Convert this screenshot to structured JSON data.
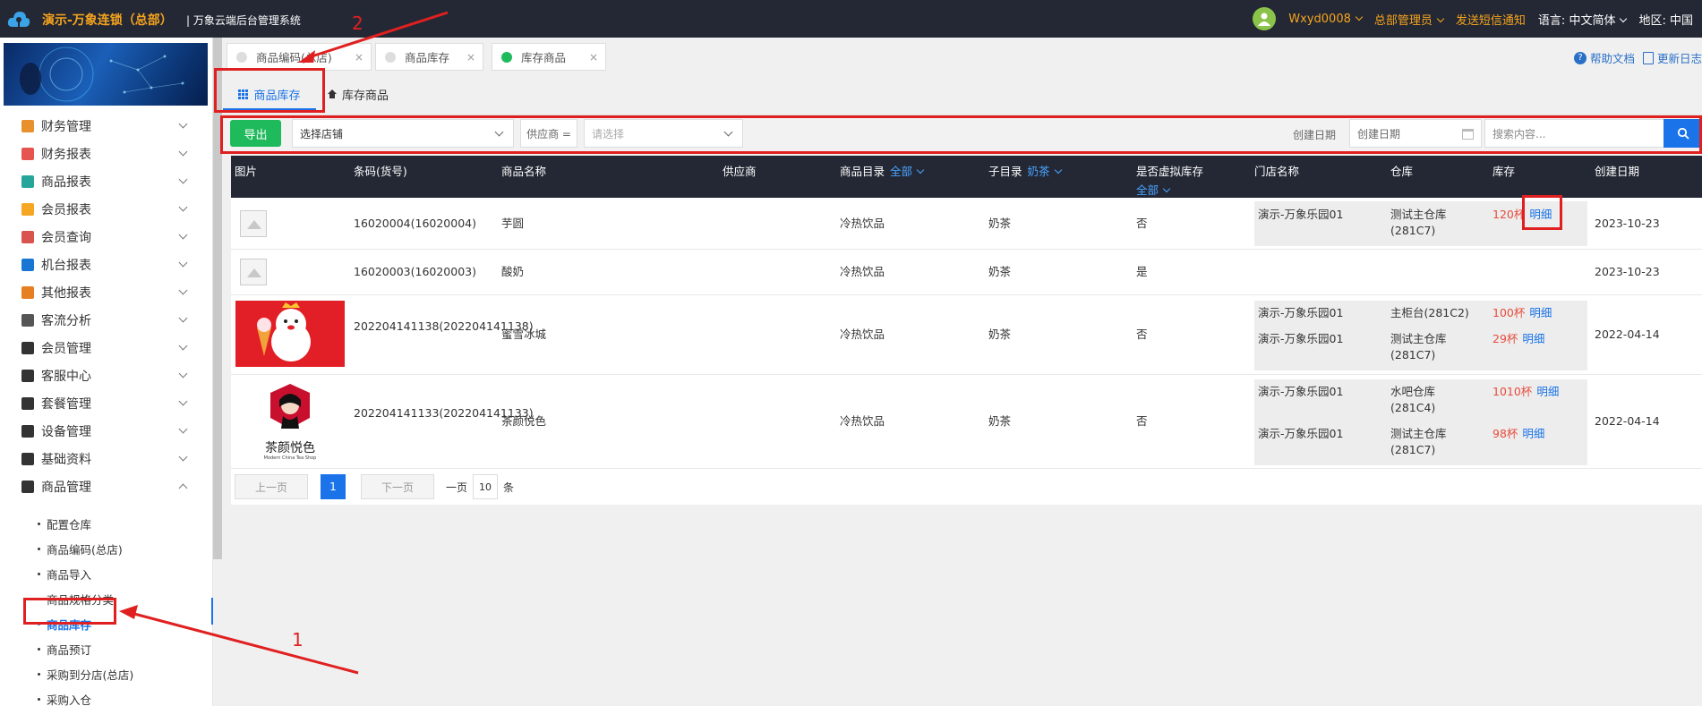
{
  "header": {
    "brand": "演示-万象连锁（总部）",
    "system_name": "| 万象云端后台管理系统",
    "user": "Wxyd0008",
    "role": "总部管理员",
    "sms": "发送短信通知",
    "lang_label": "语言:",
    "lang_value": "中文简体",
    "region_label": "地区:",
    "region_value": "中国"
  },
  "sidebar": {
    "menus": [
      {
        "label": "财务管理",
        "color": "#e8912c"
      },
      {
        "label": "财务报表",
        "color": "#e5544f"
      },
      {
        "label": "商品报表",
        "color": "#26a69a"
      },
      {
        "label": "会员报表",
        "color": "#f5a623"
      },
      {
        "label": "会员查询",
        "color": "#d9534f"
      },
      {
        "label": "机台报表",
        "color": "#1976d2"
      },
      {
        "label": "其他报表",
        "color": "#e67e22"
      },
      {
        "label": "客流分析",
        "color": "#555555"
      },
      {
        "label": "会员管理",
        "color": "#333333"
      },
      {
        "label": "客服中心",
        "color": "#333333"
      },
      {
        "label": "套餐管理",
        "color": "#333333"
      },
      {
        "label": "设备管理",
        "color": "#333333"
      },
      {
        "label": "基础资料",
        "color": "#333333"
      },
      {
        "label": "商品管理",
        "color": "#333333"
      }
    ],
    "submenu": [
      "配置仓库",
      "商品编码(总店)",
      "商品导入",
      "商品规格分类",
      "商品库存",
      "商品预订",
      "采购到分店(总店)",
      "采购入仓"
    ]
  },
  "tabs": [
    {
      "label": "商品编码(总店)",
      "close": "×"
    },
    {
      "label": "商品库存",
      "close": "×"
    },
    {
      "label": "库存商品",
      "close": "×"
    }
  ],
  "tab_colors": {
    "inactive": "#dddddd",
    "active": "#1fba5b"
  },
  "help_label": "帮助文档",
  "changelog_label": "更新日志",
  "subtabs": {
    "first": "商品库存",
    "second": "库存商品"
  },
  "toolbar": {
    "export": "导出",
    "store_placeholder": "选择店铺",
    "supplier_label": "供应商 =",
    "supplier_placeholder": "请选择",
    "date_label": "创建日期",
    "date_placeholder": "创建日期",
    "search_placeholder": "搜索内容..."
  },
  "table": {
    "headers": {
      "image": "图片",
      "barcode": "条码(货号)",
      "name": "商品名称",
      "supplier": "供应商",
      "catalog": "商品目录",
      "catalog_filter": "全部",
      "subcatalog": "子目录",
      "subcatalog_filter": "奶茶",
      "virtual": "是否虚拟库存",
      "virtual_filter": "全部",
      "store": "门店名称",
      "warehouse": "仓库",
      "stock": "库存",
      "created": "创建日期"
    },
    "rows": [
      {
        "barcode": "16020004(16020004)",
        "name": "芋圆",
        "catalog": "冷热饮品",
        "sub": "奶茶",
        "virtual": "否",
        "date": "2023-10-23",
        "stores": [
          {
            "store": "演示-万象乐园01",
            "wh": "测试主仓库(281C7)",
            "stock": "120杯",
            "detail": "明细"
          }
        ]
      },
      {
        "barcode": "16020003(16020003)",
        "name": "酸奶",
        "catalog": "冷热饮品",
        "sub": "奶茶",
        "virtual": "是",
        "date": "2023-10-23",
        "stores": []
      },
      {
        "barcode": "202204141138(202204141138)",
        "name": "蜜雪冰城",
        "catalog": "冷热饮品",
        "sub": "奶茶",
        "virtual": "否",
        "date": "2022-04-14",
        "stores": [
          {
            "store": "演示-万象乐园01",
            "wh": "主柜台(281C2)",
            "stock": "100杯",
            "detail": "明细"
          },
          {
            "store": "演示-万象乐园01",
            "wh": "测试主仓库(281C7)",
            "stock": "29杯",
            "detail": "明细"
          }
        ]
      },
      {
        "barcode": "202204141133(202204141133)",
        "name": "茶颜悦色",
        "catalog": "冷热饮品",
        "sub": "奶茶",
        "virtual": "否",
        "date": "2022-04-14",
        "stores": [
          {
            "store": "演示-万象乐园01",
            "wh": "水吧仓库(281C4)",
            "stock": "1010杯",
            "detail": "明细"
          },
          {
            "store": "演示-万象乐园01",
            "wh": "测试主仓库(281C7)",
            "stock": "98杯",
            "detail": "明细"
          }
        ]
      }
    ],
    "logo2_text": "茶颜悦色",
    "logo2_sub": "Modern China Tea Shop"
  },
  "pager": {
    "prev": "上一页",
    "current": "1",
    "next": "下一页",
    "per_page_label": "一页",
    "per_page": "10",
    "unit": "条"
  },
  "annotations": {
    "one": "1",
    "two": "2",
    "color": "#e02020"
  }
}
